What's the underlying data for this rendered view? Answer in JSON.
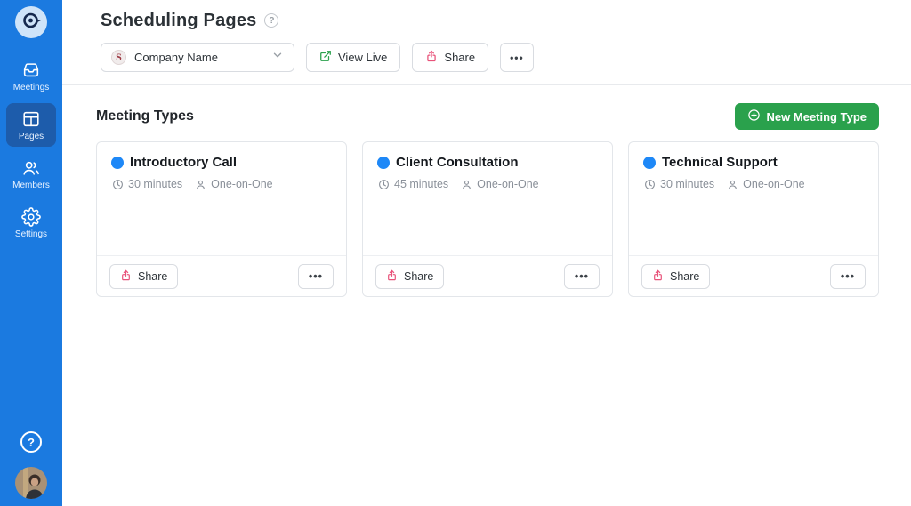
{
  "colors": {
    "sidebar_blue": "#1b7ae0",
    "sidebar_active_blue": "#1d5cab",
    "primary_green": "#2aa14c",
    "share_pink": "#e8537a",
    "meeting_dot_blue": "#1e88f7"
  },
  "sidebar": {
    "items": [
      {
        "label": "Meetings",
        "icon": "inbox-icon",
        "active": false
      },
      {
        "label": "Pages",
        "icon": "pages-icon",
        "active": true
      },
      {
        "label": "Members",
        "icon": "members-icon",
        "active": false
      },
      {
        "label": "Settings",
        "icon": "settings-icon",
        "active": false
      }
    ],
    "help_glyph": "?"
  },
  "header": {
    "title": "Scheduling Pages",
    "help_glyph": "?"
  },
  "toolbar": {
    "company_selector": {
      "value": "Company Name",
      "logo_letter": "S"
    },
    "view_live_label": "View Live",
    "share_label": "Share",
    "more_glyph": "•••"
  },
  "main": {
    "section_title": "Meeting Types",
    "new_meeting_type_label": "New Meeting Type",
    "cards": [
      {
        "title": "Introductory Call",
        "duration": "30 minutes",
        "attendee_type": "One-on-One",
        "share_label": "Share",
        "more_glyph": "•••"
      },
      {
        "title": "Client Consultation",
        "duration": "45 minutes",
        "attendee_type": "One-on-One",
        "share_label": "Share",
        "more_glyph": "•••"
      },
      {
        "title": "Technical Support",
        "duration": "30 minutes",
        "attendee_type": "One-on-One",
        "share_label": "Share",
        "more_glyph": "•••"
      }
    ]
  }
}
